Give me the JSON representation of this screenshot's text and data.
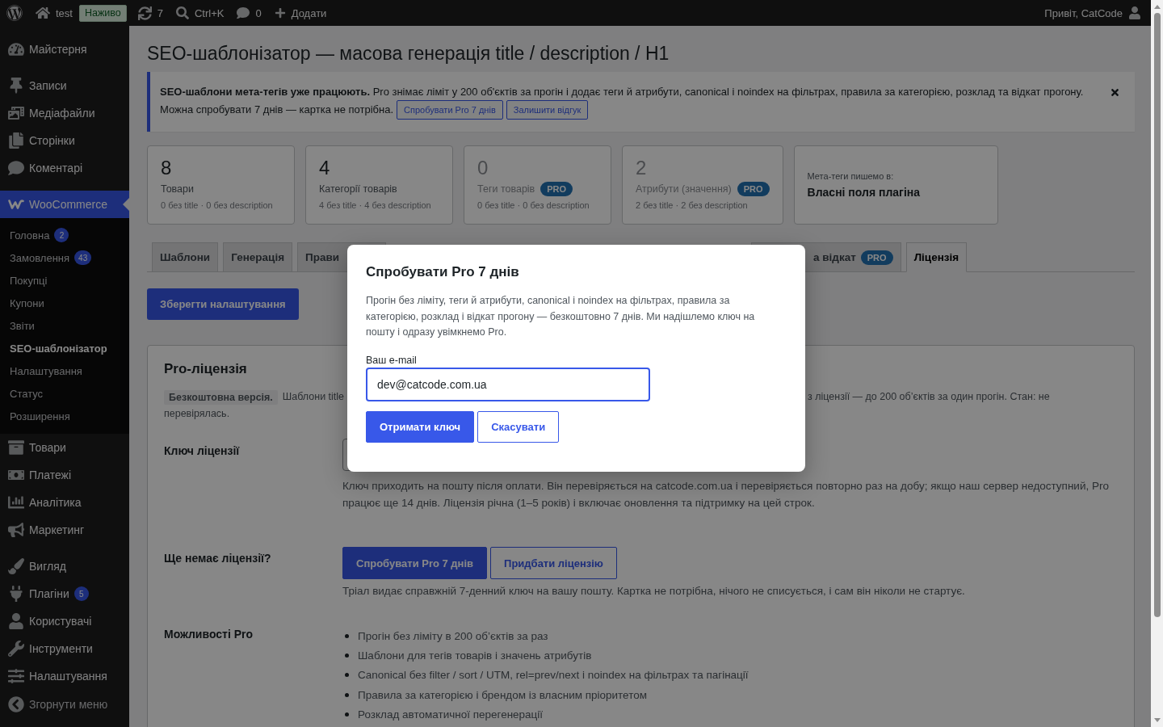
{
  "admin_bar": {
    "site_name": "test",
    "live_badge": "Наживо",
    "updates_count": "7",
    "search_shortcut": "Ctrl+K",
    "comments_count": "0",
    "new_label": "Додати",
    "greeting": "Привіт, CatCode"
  },
  "sidebar": {
    "groups": [
      {
        "items": [
          {
            "label": "Майстерня",
            "selected": false
          }
        ]
      },
      {
        "items": [
          {
            "label": "Записи",
            "selected": false
          },
          {
            "label": "Медіафайли",
            "selected": false
          },
          {
            "label": "Сторінки",
            "selected": false
          },
          {
            "label": "Коментарі",
            "selected": false
          }
        ]
      },
      {
        "items": [
          {
            "label": "WooCommerce",
            "selected": true,
            "submenu": [
              {
                "label": "Головна",
                "badge": "2",
                "selected": false
              },
              {
                "label": "Замовлення",
                "badge": "43",
                "selected": false
              },
              {
                "label": "Покупці",
                "selected": false
              },
              {
                "label": "Купони",
                "selected": false
              },
              {
                "label": "Звіти",
                "selected": false
              },
              {
                "label": "SEO-шаблонізатор",
                "selected": true
              },
              {
                "label": "Налаштування",
                "selected": false
              },
              {
                "label": "Статус",
                "selected": false
              },
              {
                "label": "Розширення",
                "selected": false
              }
            ]
          },
          {
            "label": "Товари",
            "selected": false
          },
          {
            "label": "Платежі",
            "selected": false
          },
          {
            "label": "Аналітика",
            "selected": false
          },
          {
            "label": "Маркетинг",
            "selected": false
          }
        ]
      },
      {
        "items": [
          {
            "label": "Вигляд",
            "selected": false
          },
          {
            "label": "Плагіни",
            "badge": "5",
            "selected": false
          },
          {
            "label": "Користувачі",
            "selected": false
          },
          {
            "label": "Інструменти",
            "selected": false
          },
          {
            "label": "Налаштування",
            "selected": false
          }
        ]
      }
    ],
    "collapse_label": "Згорнути меню"
  },
  "page": {
    "title": "SEO-шаблонізатор — масова генерація title / description / H1",
    "notice": {
      "text": "**SEO-шаблони мета-тегів уже працюють.** Pro знімає ліміт у 200 об'єктів за прогін і додає теги й атрибути, canonical і noindex на фільтрах, правила за категорією, розклад та відкат прогону.",
      "hint": "Можна спробувати 7 днів — картка не потрібна.",
      "buttons": [
        "Спробувати Pro 7 днів",
        "Залишити відгук"
      ]
    },
    "stats": [
      {
        "value": "8",
        "label": "Товари",
        "detail": "0 без title · 0 без description",
        "locked": false
      },
      {
        "value": "4",
        "label": "Категорії товарів",
        "detail": "4 без title · 4 без description",
        "locked": false
      },
      {
        "value": "0",
        "label": "Теги товарів",
        "badge": "PRO",
        "detail": "0 без title · 0 без description",
        "locked": true
      },
      {
        "value": "2",
        "label": "Атрибути (значення)",
        "badge": "PRO",
        "detail": "2 без title · 2 без description",
        "locked": true
      }
    ],
    "storage": {
      "label": "Мета-теги пишемо в:",
      "value": "Власні поля плагіна"
    },
    "tabs": [
      {
        "label": "Шаблони",
        "selected": false
      },
      {
        "label": "Генерація",
        "selected": false
      },
      {
        "label": "Прави",
        "selected": false
      },
      {
        "label": "а відкат",
        "badge": "PRO",
        "selected": false
      },
      {
        "label": "Ліцензія",
        "selected": true
      }
    ],
    "save_button": "Зберегти налаштування",
    "license_card": {
      "title": "Pro-ліцензія",
      "status_badge": "Безкоштовна версія.",
      "status_text_parts": [
        "Шаблони title",
        "з ліцензії — до 200 об’єктів за один прогін. Стан: не",
        "перевірялась."
      ],
      "key_row": {
        "label": "Ключ ліцензії",
        "help": "Ключ приходить на пошту після оплати. Він перевіряється на catcode.com.ua і перевіряється повторно раз на добу; якщо наш сервер недоступний, Pro працює ще 14 днів. Ліцензія річна (1–5 років) і включає оновлення та підтримку на цей строк."
      },
      "trial_row": {
        "label": "Ще немає ліцензії?",
        "buttons": [
          {
            "label": "Спробувати Pro 7 днів",
            "kind": "primary"
          },
          {
            "label": "Придбати ліцензію",
            "kind": "secondary"
          }
        ],
        "note": "Тріал видає справжній 7-денний ключ на вашу пошту. Картка не потрібна, нічого не списується, і сам він ніколи не стартує."
      },
      "features_row": {
        "label": "Можливості Pro",
        "items": [
          "Прогін без ліміту в 200 об’єктів за раз",
          "Шаблони для тегів товарів і значень атрибутів",
          "Canonical без filter / sort / UTM, rel=prev/next і noindex на фільтрах та пагінації",
          "Правила за категорією і брендом із власним пріоритетом",
          "Розклад автоматичної перегенерації"
        ]
      }
    }
  },
  "modal": {
    "title": "Спробувати Pro 7 днів",
    "text": "Прогін без ліміту, теги й атрибути, canonical і noindex на фільтрах, правила за категорією, розклад і відкат прогону — безкоштовно 7 днів. Ми надішлемо ключ на пошту і одразу увімкнемо Pro.",
    "email": {
      "label": "Ваш e-mail",
      "value": "dev@catcode.com.ua",
      "focused": true
    },
    "buttons": [
      {
        "label": "Отримати ключ",
        "kind": "primary"
      },
      {
        "label": "Скасувати",
        "kind": "secondary"
      }
    ]
  }
}
